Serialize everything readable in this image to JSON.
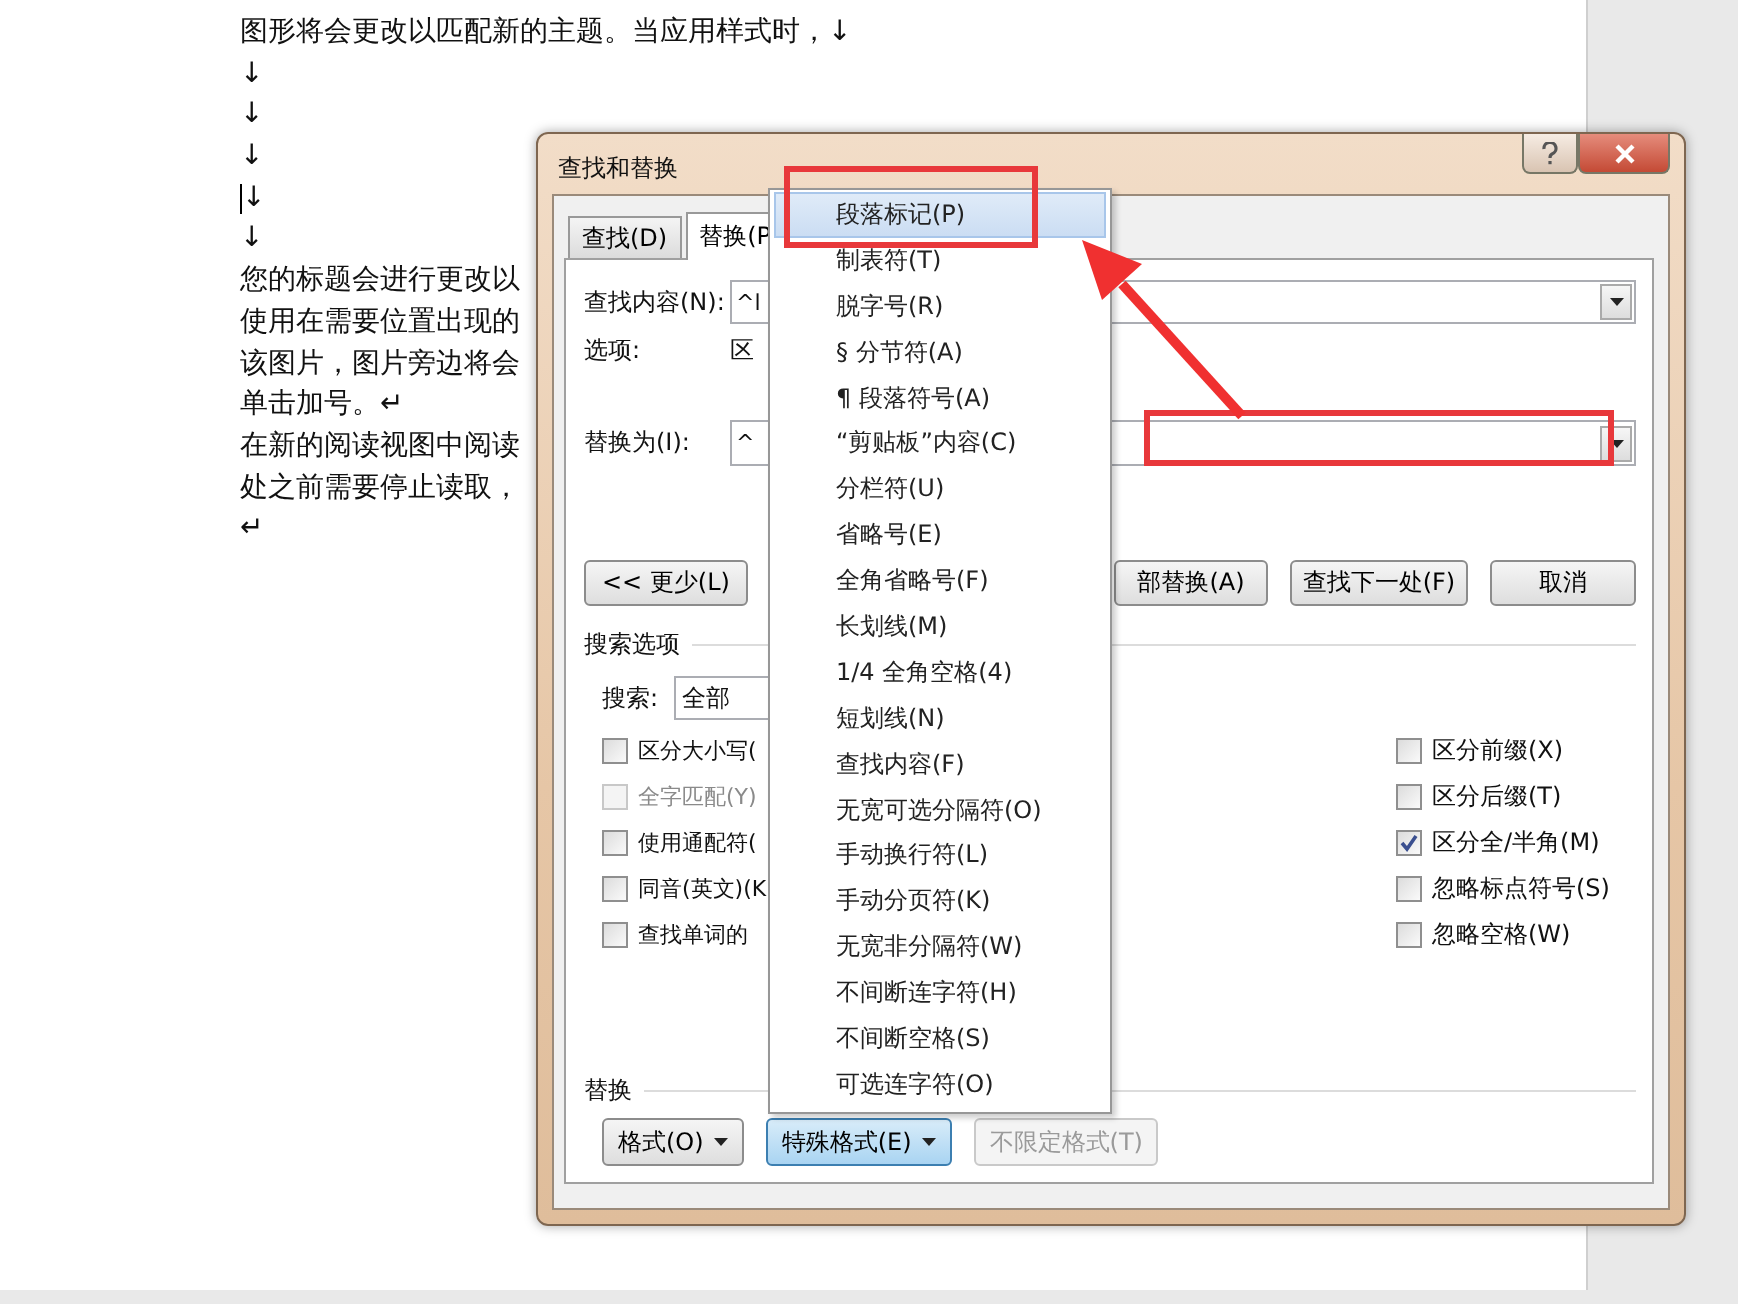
{
  "document": {
    "lines": [
      {
        "text": "图形将会更改以匹配新的主题。当应用样式时，↓",
        "cursor": false
      },
      {
        "text": "↓",
        "cursor": false
      },
      {
        "text": "↓",
        "cursor": false
      },
      {
        "text": "↓",
        "cursor": false
      },
      {
        "text": "↓",
        "cursor": true
      },
      {
        "text": "↓",
        "cursor": false
      },
      {
        "text": "您的标题会进行更改以",
        "cursor": false
      },
      {
        "text": "使用在需要位置出现的",
        "cursor": false
      },
      {
        "text": "该图片，图片旁边将会",
        "cursor": false
      },
      {
        "text": "单击加号。↵",
        "cursor": false
      },
      {
        "text": "在新的阅读视图中阅读",
        "cursor": false
      },
      {
        "text": "处之前需要停止读取，",
        "cursor": false
      },
      {
        "text": "↵",
        "cursor": false
      }
    ]
  },
  "dialog": {
    "title": "查找和替换",
    "tabs": [
      {
        "label": "查找(D)",
        "selected": false
      },
      {
        "label": "替换(P",
        "selected": true
      }
    ],
    "find": {
      "label": "查找内容(N):",
      "value": "^l"
    },
    "options": {
      "label": "选项:",
      "value": "区"
    },
    "replace": {
      "label": "替换为(I):",
      "value": "^"
    },
    "buttons": [
      {
        "label": "<< 更少(L)"
      },
      {
        "label": "部替换(A)"
      },
      {
        "label": "查找下一处(F)"
      },
      {
        "label": "取消"
      }
    ],
    "search_options": {
      "heading": "搜索选项",
      "search_label": "搜索:",
      "search_value": "全部",
      "left_checkboxes": [
        {
          "label": "区分大小写(",
          "checked": false,
          "disabled": false
        },
        {
          "label": "全字匹配(Y)",
          "checked": false,
          "disabled": true
        },
        {
          "label": "使用通配符(",
          "checked": false,
          "disabled": false
        },
        {
          "label": "同音(英文)(K",
          "checked": false,
          "disabled": false
        },
        {
          "label": "查找单词的",
          "checked": false,
          "disabled": false
        }
      ],
      "right_checkboxes": [
        {
          "label": "区分前缀(X)",
          "checked": false,
          "disabled": false
        },
        {
          "label": "区分后缀(T)",
          "checked": false,
          "disabled": false
        },
        {
          "label": "区分全/半角(M)",
          "checked": true,
          "disabled": false
        },
        {
          "label": "忽略标点符号(S)",
          "checked": false,
          "disabled": false
        },
        {
          "label": "忽略空格(W)",
          "checked": false,
          "disabled": false
        }
      ]
    },
    "replace_section": {
      "heading": "替换",
      "buttons": [
        {
          "label": "格式(O)",
          "dropdown": true,
          "pressed": false,
          "disabled": false
        },
        {
          "label": "特殊格式(E)",
          "dropdown": true,
          "pressed": true,
          "disabled": false
        },
        {
          "label": "不限定格式(T)",
          "dropdown": false,
          "pressed": false,
          "disabled": true
        }
      ]
    }
  },
  "special_menu": {
    "items": [
      {
        "label": "段落标记(P)",
        "selected": true
      },
      {
        "label": "制表符(T)",
        "selected": false
      },
      {
        "label": "脱字号(R)",
        "selected": false
      },
      {
        "label": "§ 分节符(A)",
        "selected": false
      },
      {
        "label": "¶ 段落符号(A)",
        "selected": false
      },
      {
        "label": "“剪贴板”内容(C)",
        "selected": false
      },
      {
        "label": "分栏符(U)",
        "selected": false
      },
      {
        "label": "省略号(E)",
        "selected": false
      },
      {
        "label": "全角省略号(F)",
        "selected": false
      },
      {
        "label": "长划线(M)",
        "selected": false
      },
      {
        "label": "1/4 全角空格(4)",
        "selected": false
      },
      {
        "label": "短划线(N)",
        "selected": false
      },
      {
        "label": "查找内容(F)",
        "selected": false
      },
      {
        "label": "无宽可选分隔符(O)",
        "selected": false
      },
      {
        "label": "手动换行符(L)",
        "selected": false
      },
      {
        "label": "手动分页符(K)",
        "selected": false
      },
      {
        "label": "无宽非分隔符(W)",
        "selected": false
      },
      {
        "label": "不间断连字符(H)",
        "selected": false
      },
      {
        "label": "不间断空格(S)",
        "selected": false
      },
      {
        "label": "可选连字符(O)",
        "selected": false
      }
    ]
  }
}
